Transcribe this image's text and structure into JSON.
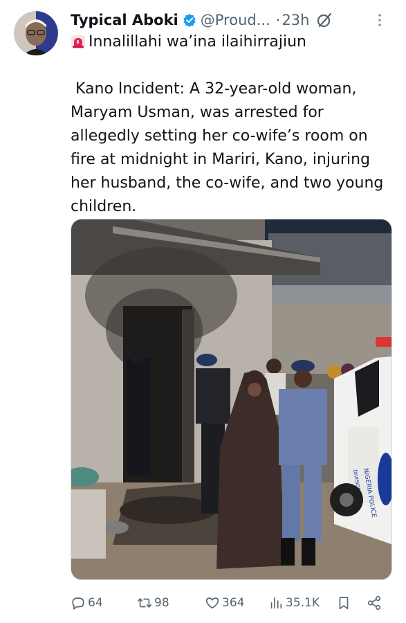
{
  "author": {
    "display_name": "Typical Aboki",
    "handle": "@Proud...",
    "separator": "·",
    "time": "23h",
    "verified": true,
    "verified_color": "#1d9bf0",
    "avatar_colors": [
      "#2d3b8a",
      "#d7c1a8"
    ]
  },
  "tweet": {
    "first_line": "Innalillahi wa’ina ilaihirrajiun",
    "first_line_icon": "siren-icon",
    "body": " Kano Incident: A 32-year-old woman, Maryam Usman, was arrested for allegedly setting her co-wife’s room on fire at midnight in Mariri, Kano, injuring her husband, the co-wife, and two young children."
  },
  "media": {
    "vehicle_text_1": "NIGERIA POLICE",
    "vehicle_text_2": "DIVISIONAL"
  },
  "actions": {
    "replies": "64",
    "retweets": "98",
    "likes": "364",
    "views": "35.1K"
  },
  "colors": {
    "text": "#0f1419",
    "secondary": "#536471",
    "accent": "#1d9bf0"
  }
}
